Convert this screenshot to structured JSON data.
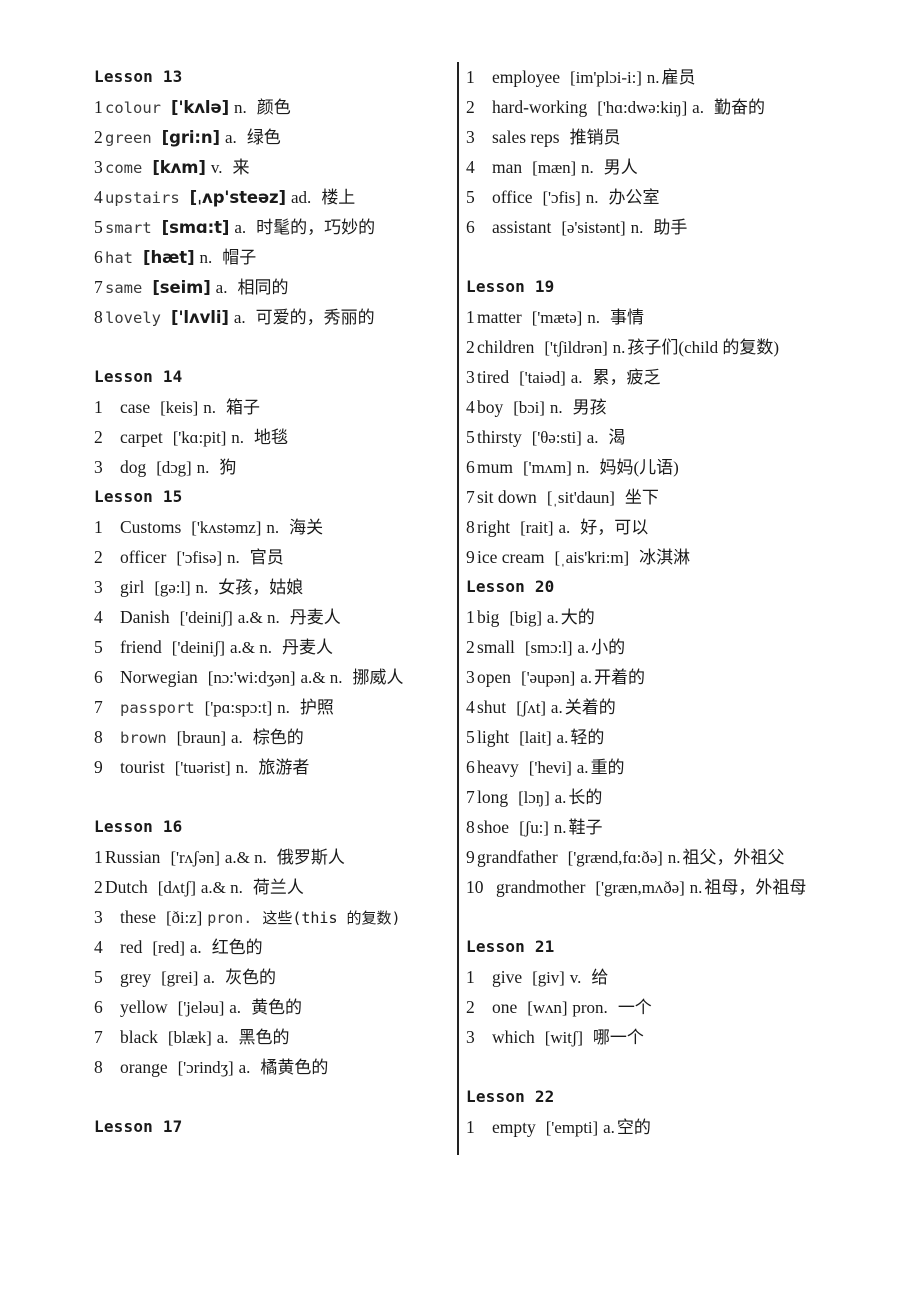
{
  "document": {
    "type": "vocabulary-list",
    "columns": 2,
    "divider": true,
    "text_color": "#1a1a1a"
  },
  "left_column": {
    "blocks": [
      {
        "heading": "Lesson  13",
        "heading_style": "mono",
        "idx_width": "narrow",
        "entries": [
          {
            "n": "1",
            "word": "colour",
            "word_style": "mono",
            "phon": "['kʌlə]",
            "phon_style": "bold",
            "pos": "n.",
            "cn": "颜色"
          },
          {
            "n": "2",
            "word": "green",
            "word_style": "mono",
            "phon": "[gri:n]",
            "phon_style": "bold",
            "pos": "a.",
            "cn": "绿色"
          },
          {
            "n": "3",
            "word": "come",
            "word_style": "mono",
            "phon": "[kʌm]",
            "phon_style": "bold",
            "pos": "v.",
            "cn": "来"
          },
          {
            "n": "4",
            "word": "upstairs",
            "word_style": "mono",
            "phon": "[ˌʌp'steəz]",
            "phon_style": "bold",
            "pos": "ad.",
            "cn": "楼上"
          },
          {
            "n": "5",
            "word": "smart",
            "word_style": "mono",
            "phon": "[smɑ:t]",
            "phon_style": "bold",
            "pos": "a.",
            "cn": "时髦的，巧妙的"
          },
          {
            "n": "6",
            "word": "hat",
            "word_style": "mono",
            "phon": "[hæt]",
            "phon_style": "bold",
            "pos": "n.",
            "cn": "帽子"
          },
          {
            "n": "7",
            "word": "same",
            "word_style": "mono",
            "phon": "[seim]",
            "phon_style": "bold",
            "pos": "a.",
            "cn": "相同的"
          },
          {
            "n": "8",
            "word": "lovely",
            "word_style": "mono",
            "phon": "['lʌvli]",
            "phon_style": "bold",
            "pos": "a.",
            "cn": "可爱的，秀丽的"
          }
        ]
      },
      {
        "heading": "Lesson  14",
        "heading_style": "mono",
        "idx_width": "wide",
        "entries": [
          {
            "n": "1",
            "word": "case",
            "word_style": "serif",
            "phon": "[keis]",
            "phon_style": "serif",
            "pos": "n.",
            "cn": "箱子"
          },
          {
            "n": "2",
            "word": "carpet",
            "word_style": "serif",
            "phon": "['kɑ:pit]",
            "phon_style": "serif",
            "pos": "n.",
            "cn": "地毯"
          },
          {
            "n": "3",
            "word": "dog",
            "word_style": "serif",
            "phon": "[dɔg]",
            "phon_style": "serif",
            "pos": "n.",
            "cn": "狗"
          }
        ]
      },
      {
        "heading": "Lesson  15",
        "heading_style": "mono",
        "idx_width": "wide",
        "entries": [
          {
            "n": "1",
            "word": "Customs",
            "word_style": "serif",
            "phon": "['kʌstəmz]",
            "phon_style": "serif",
            "pos": "n.",
            "cn": "海关"
          },
          {
            "n": "2",
            "word": "officer",
            "word_style": "serif",
            "phon": "['ɔfisə]",
            "phon_style": "serif",
            "pos": "n.",
            "cn": "官员"
          },
          {
            "n": "3",
            "word": "girl",
            "word_style": "serif",
            "phon": "[gə:l]",
            "phon_style": "serif",
            "pos": "n.",
            "cn": "女孩，姑娘"
          },
          {
            "n": "4",
            "word": "Danish",
            "word_style": "serif",
            "phon": "['deiniʃ]",
            "phon_style": "serif",
            "pos": "a.& n.",
            "cn": "丹麦人"
          },
          {
            "n": "5",
            "word": "friend",
            "word_style": "serif",
            "phon": "['deiniʃ]",
            "phon_style": "serif",
            "pos": "a.& n.",
            "cn": "丹麦人"
          },
          {
            "n": "6",
            "word": "Norwegian",
            "word_style": "serif",
            "phon": "[nɔ:'wi:dʒən]",
            "phon_style": "serif",
            "pos": "a.& n.",
            "cn": "挪威人"
          },
          {
            "n": "7",
            "word": "passport",
            "word_style": "mono",
            "phon": "['pɑ:spɔ:t]",
            "phon_style": "serif",
            "pos": "n.",
            "cn": "护照"
          },
          {
            "n": "8",
            "word": "brown",
            "word_style": "mono",
            "phon": "[braun]",
            "phon_style": "serif",
            "pos": "a.",
            "cn": "棕色的"
          },
          {
            "n": "9",
            "word": "tourist",
            "word_style": "serif",
            "phon": "['tuərist]",
            "phon_style": "serif",
            "pos": "n.",
            "cn": "旅游者"
          }
        ]
      },
      {
        "heading": "Lesson  16",
        "heading_style": "mono",
        "idx_width": "wide",
        "entries": [
          {
            "n": "1",
            "word": "Russian",
            "word_style": "serif",
            "phon": "['rʌʃən]",
            "phon_style": "serif",
            "pos": "a.& n.",
            "cn": "俄罗斯人",
            "idx_width": "narrow"
          },
          {
            "n": "2",
            "word": "Dutch",
            "word_style": "serif",
            "phon": "[dʌtʃ]",
            "phon_style": "serif",
            "pos": "a.& n.",
            "cn": "荷兰人",
            "idx_width": "narrow"
          },
          {
            "n": "3",
            "word": "these",
            "word_style": "serif",
            "phon": "[ði:z]",
            "phon_style": "serif",
            "pos": "pron.",
            "cn": "这些(this 的复数)",
            "pos_style": "mono",
            "cn_style": "mono"
          },
          {
            "n": "4",
            "word": "red",
            "word_style": "serif",
            "phon": "[red]",
            "phon_style": "serif",
            "pos": "a.",
            "cn": "红色的"
          },
          {
            "n": "5",
            "word": "grey",
            "word_style": "serif",
            "phon": "[grei]",
            "phon_style": "serif",
            "pos": "a.",
            "cn": "灰色的"
          },
          {
            "n": "6",
            "word": "yellow",
            "word_style": "serif",
            "phon": "['jeləu]",
            "phon_style": "serif",
            "pos": "a.",
            "cn": "黄色的"
          },
          {
            "n": "7",
            "word": "black",
            "word_style": "serif",
            "phon": "[blæk]",
            "phon_style": "serif",
            "pos": "a.",
            "cn": "黑色的"
          },
          {
            "n": "8",
            "word": "orange",
            "word_style": "serif",
            "phon": "['ɔrindʒ]",
            "phon_style": "serif",
            "pos": "a.",
            "cn": "橘黄色的"
          }
        ]
      },
      {
        "heading": "Lesson  17",
        "heading_style": "mono",
        "idx_width": "wide",
        "entries": []
      }
    ]
  },
  "right_column": {
    "blocks": [
      {
        "heading": null,
        "idx_width": "wide",
        "entries": [
          {
            "n": "1",
            "word": "employee",
            "word_style": "serif",
            "phon": "[im'plɔi-i:]",
            "phon_style": "serif",
            "pos": "n.",
            "cn": "雇员",
            "tight": true
          },
          {
            "n": "2",
            "word": "hard-working",
            "word_style": "serif",
            "phon": "['hɑ:dwə:kiŋ]",
            "phon_style": "serif",
            "pos": "a.",
            "cn": "勤奋的"
          },
          {
            "n": "3",
            "word": "sales reps",
            "word_style": "serif",
            "phon": "",
            "phon_style": "serif",
            "pos": "",
            "cn": "推销员"
          },
          {
            "n": "4",
            "word": "man",
            "word_style": "serif",
            "phon": "[mæn]",
            "phon_style": "serif",
            "pos": "n.",
            "cn": "男人"
          },
          {
            "n": "5",
            "word": "office",
            "word_style": "serif",
            "phon": "['ɔfis]",
            "phon_style": "serif",
            "pos": "n.",
            "cn": "办公室"
          },
          {
            "n": "6",
            "word": "assistant",
            "word_style": "serif",
            "phon": "[ə'sistənt]",
            "phon_style": "serif",
            "pos": "n.",
            "cn": "助手"
          }
        ]
      },
      {
        "heading": "Lesson  19",
        "heading_style": "mono",
        "idx_width": "narrow",
        "entries": [
          {
            "n": "1",
            "word": "matter",
            "word_style": "serif",
            "phon": "['mætə]",
            "phon_style": "serif",
            "pos": "n.",
            "cn": "事情"
          },
          {
            "n": "2",
            "word": "children",
            "word_style": "serif",
            "phon": "['tʃildrən]",
            "phon_style": "serif",
            "pos": "n.",
            "cn": "孩子们(child 的复数)",
            "tight": true
          },
          {
            "n": "3",
            "word": "tired",
            "word_style": "serif",
            "phon": "['taiəd]",
            "phon_style": "serif",
            "pos": "a.",
            "cn": "累，疲乏"
          },
          {
            "n": "4",
            "word": "boy",
            "word_style": "serif",
            "phon": "[bɔi]",
            "phon_style": "serif",
            "pos": "n.",
            "cn": "男孩"
          },
          {
            "n": "5",
            "word": "thirsty",
            "word_style": "serif",
            "phon": "['θə:sti]",
            "phon_style": "serif",
            "pos": "a.",
            "cn": "渴"
          },
          {
            "n": "6",
            "word": "mum",
            "word_style": "serif",
            "phon": "['mʌm]",
            "phon_style": "serif",
            "pos": "n.",
            "cn": "妈妈(儿语)"
          },
          {
            "n": "7",
            "word": "sit down",
            "word_style": "serif",
            "phon": "[ˌsit'daun]",
            "phon_style": "serif",
            "pos": "",
            "cn": "坐下"
          },
          {
            "n": "8",
            "word": "right",
            "word_style": "serif",
            "phon": "[rait]",
            "phon_style": "serif",
            "pos": "a.",
            "cn": "好，可以"
          },
          {
            "n": "9",
            "word": "ice cream",
            "word_style": "serif",
            "phon": "[ˌais'kri:m]",
            "phon_style": "serif",
            "pos": "",
            "cn": "冰淇淋"
          }
        ]
      },
      {
        "heading": "Lesson  20",
        "heading_style": "mono",
        "idx_width": "narrow",
        "entries": [
          {
            "n": "1",
            "word": "big",
            "word_style": "serif",
            "phon": "[big]",
            "phon_style": "serif",
            "pos": "a.",
            "cn": "大的",
            "tight": true
          },
          {
            "n": "2",
            "word": "small",
            "word_style": "serif",
            "phon": "[smɔ:l]",
            "phon_style": "serif",
            "pos": "a.",
            "cn": "小的",
            "tight": true
          },
          {
            "n": "3",
            "word": "open",
            "word_style": "serif",
            "phon": "['əupən]",
            "phon_style": "serif",
            "pos": "a.",
            "cn": "开着的",
            "tight": true
          },
          {
            "n": "4",
            "word": "shut",
            "word_style": "serif",
            "phon": "[ʃʌt]",
            "phon_style": "serif",
            "pos": "a.",
            "cn": "关着的",
            "tight": true
          },
          {
            "n": "5",
            "word": "light",
            "word_style": "serif",
            "phon": "[lait]",
            "phon_style": "serif",
            "pos": "a.",
            "cn": "轻的",
            "tight": true
          },
          {
            "n": "6",
            "word": "heavy",
            "word_style": "serif",
            "phon": "['hevi]",
            "phon_style": "serif",
            "pos": "a.",
            "cn": "重的",
            "tight": true
          },
          {
            "n": "7",
            "word": "long",
            "word_style": "serif",
            "phon": "[lɔŋ]",
            "phon_style": "serif",
            "pos": "a.",
            "cn": "长的",
            "tight": true
          },
          {
            "n": "8",
            "word": "shoe",
            "word_style": "serif",
            "phon": "[ʃu:]",
            "phon_style": "serif",
            "pos": "n.",
            "cn": "鞋子",
            "tight": true
          },
          {
            "n": "9",
            "word": "grandfather",
            "word_style": "serif",
            "phon": "['grænd,fɑ:ðə]",
            "phon_style": "serif",
            "pos": "n.",
            "cn": "祖父，外祖父",
            "tight": true
          },
          {
            "n": "10",
            "word": "grandmother",
            "word_style": "serif",
            "phon": "['græn,mʌðə]",
            "phon_style": "serif",
            "pos": "n.",
            "cn": "祖母，外祖母",
            "tight": true,
            "idx_width": "xwide"
          }
        ]
      },
      {
        "heading": "Lesson  21",
        "heading_style": "mono",
        "idx_width": "wide",
        "entries": [
          {
            "n": "1",
            "word": "give",
            "word_style": "serif",
            "phon": "[giv]",
            "phon_style": "serif",
            "pos": "v.",
            "cn": "给"
          },
          {
            "n": "2",
            "word": "one",
            "word_style": "serif",
            "phon": "[wʌn]",
            "phon_style": "serif",
            "pos": "pron.",
            "cn": "一个"
          },
          {
            "n": "3",
            "word": "which",
            "word_style": "serif",
            "phon": "[witʃ]",
            "phon_style": "serif",
            "pos": "",
            "cn": "哪一个"
          }
        ]
      },
      {
        "heading": "Lesson  22",
        "heading_style": "mono",
        "idx_width": "wide",
        "entries": [
          {
            "n": "1",
            "word": "empty",
            "word_style": "serif",
            "phon": "['empti]",
            "phon_style": "serif",
            "pos": "a.",
            "cn": "空的",
            "tight": true
          }
        ]
      }
    ]
  }
}
